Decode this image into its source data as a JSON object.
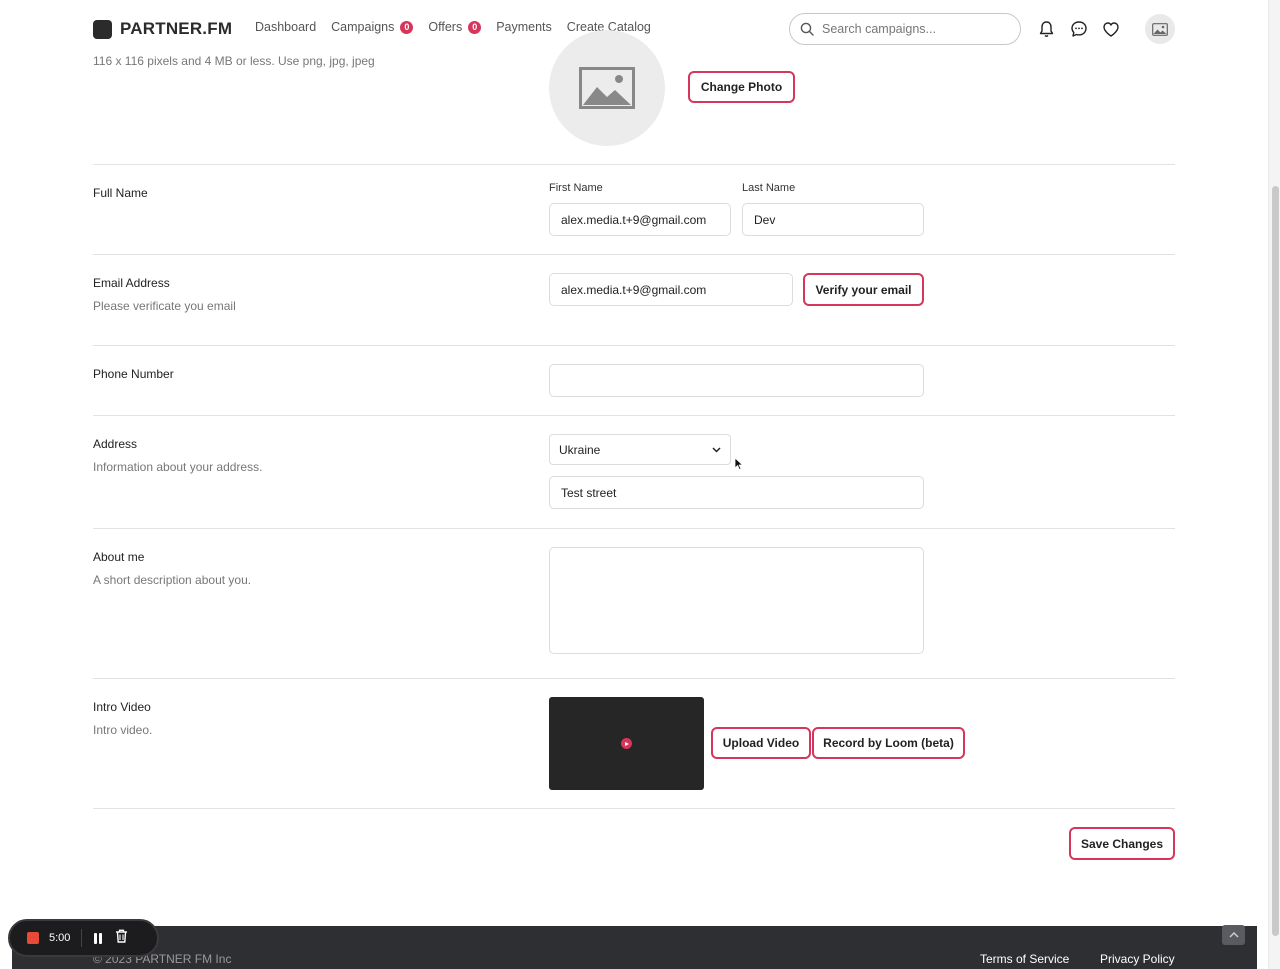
{
  "header": {
    "logo_text": "PARTNER.FM",
    "nav": [
      {
        "label": "Dashboard",
        "badge": null
      },
      {
        "label": "Campaigns",
        "badge": "0"
      },
      {
        "label": "Offers",
        "badge": "0"
      },
      {
        "label": "Payments",
        "badge": null
      },
      {
        "label": "Create Catalog",
        "badge": null
      }
    ],
    "search_placeholder": "Search campaigns..."
  },
  "photo": {
    "hint": "116 x 116 pixels and 4 MB or less. Use png, jpg, jpeg",
    "change_button": "Change Photo"
  },
  "full_name": {
    "label": "Full Name",
    "first_label": "First Name",
    "first_value": "alex.media.t+9@gmail.com",
    "last_label": "Last Name",
    "last_value": "Dev"
  },
  "email": {
    "label": "Email Address",
    "sub": "Please verificate you email",
    "value": "alex.media.t+9@gmail.com",
    "verify_button": "Verify your email"
  },
  "phone": {
    "label": "Phone Number",
    "value": ""
  },
  "address": {
    "label": "Address",
    "sub": "Information about your address.",
    "country": "Ukraine",
    "street": "Test street"
  },
  "about": {
    "label": "About me",
    "sub": "A short description about you.",
    "value": ""
  },
  "intro_video": {
    "label": "Intro Video",
    "sub": "Intro video.",
    "upload_button": "Upload Video",
    "loom_button": "Record by Loom (beta)"
  },
  "save_button": "Save Changes",
  "footer": {
    "copyright": "© 2023 PARTNER FM Inc",
    "links": [
      "Terms of Service",
      "Privacy Policy"
    ]
  },
  "recorder": {
    "time": "5:00"
  },
  "colors": {
    "accent": "#d6365b",
    "footer_bg": "#2e2f33"
  }
}
